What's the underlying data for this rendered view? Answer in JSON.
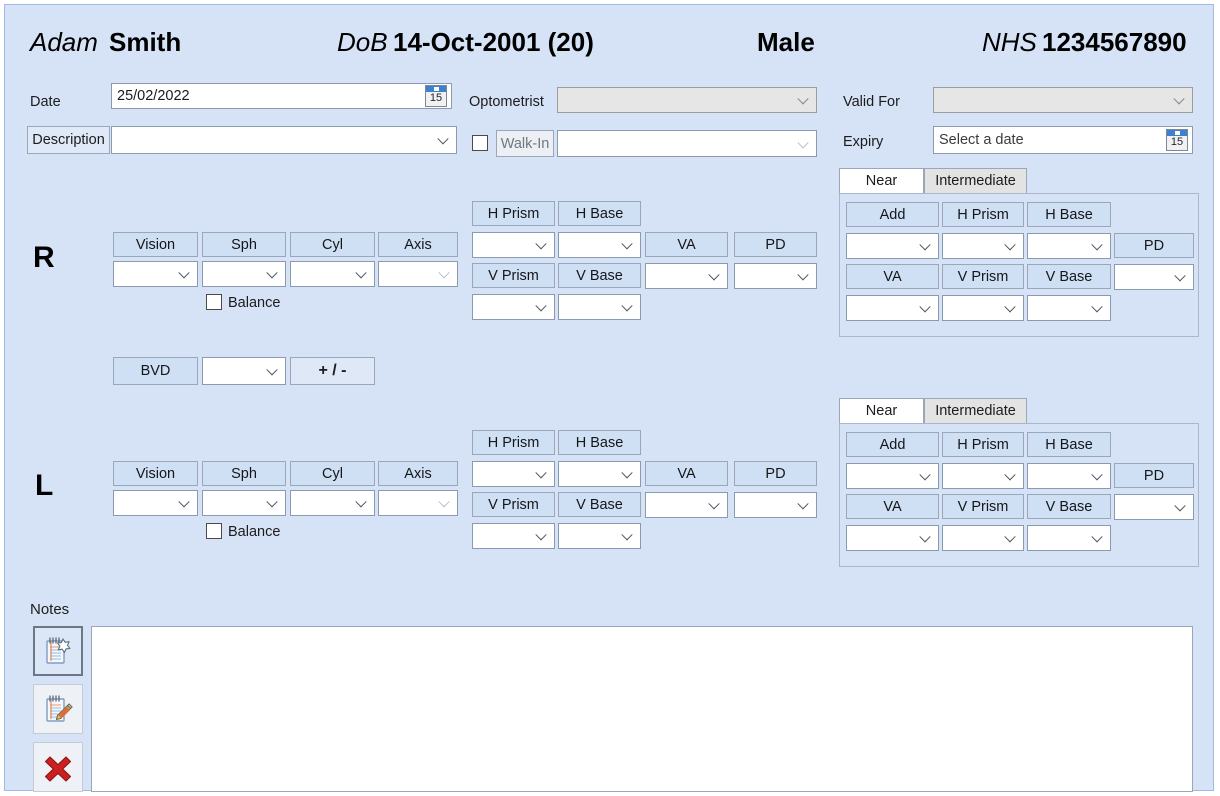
{
  "patient": {
    "first_name": "Adam",
    "last_name": "Smith",
    "dob_label": "DoB",
    "dob_value": "14-Oct-2001 (20)",
    "sex": "Male",
    "nhs_label": "NHS",
    "nhs_value": "1234567890"
  },
  "form": {
    "date_label": "Date",
    "date_value": "25/02/2022",
    "date_picker_icon": "calendar-icon",
    "date_picker_day": "15",
    "description_label": "Description",
    "description_value": "",
    "optometrist_label": "Optometrist",
    "optometrist_value": "",
    "walkin_label": "Walk-In",
    "walkin_checked": false,
    "walkin_value": "",
    "valid_for_label": "Valid For",
    "valid_for_value": "",
    "expiry_label": "Expiry",
    "expiry_placeholder": "Select a date",
    "expiry_picker_icon": "calendar-icon",
    "expiry_picker_day": "15"
  },
  "rx_headers": {
    "vision": "Vision",
    "sph": "Sph",
    "cyl": "Cyl",
    "axis": "Axis",
    "h_prism": "H Prism",
    "h_base": "H Base",
    "v_prism": "V Prism",
    "v_base": "V Base",
    "va": "VA",
    "pd": "PD",
    "add": "Add",
    "balance": "Balance"
  },
  "bvd": {
    "label": "BVD",
    "value": "",
    "sign_toggle_label": "+ / -"
  },
  "eyes": [
    {
      "id": "right",
      "letter": "R",
      "balance_checked": false,
      "vision": "",
      "sph": "",
      "cyl": "",
      "axis": "",
      "h_prism": "",
      "h_base": "",
      "v_prism": "",
      "v_base": "",
      "va": "",
      "pd": "",
      "tabs": [
        {
          "label": "Near",
          "active": true
        },
        {
          "label": "Intermediate",
          "active": false
        }
      ],
      "near": {
        "add": "",
        "h_prism": "",
        "h_base": "",
        "va": "",
        "v_prism": "",
        "v_base": "",
        "pd": ""
      }
    },
    {
      "id": "left",
      "letter": "L",
      "balance_checked": false,
      "vision": "",
      "sph": "",
      "cyl": "",
      "axis": "",
      "h_prism": "",
      "h_base": "",
      "v_prism": "",
      "v_base": "",
      "va": "",
      "pd": "",
      "tabs": [
        {
          "label": "Near",
          "active": true
        },
        {
          "label": "Intermediate",
          "active": false
        }
      ],
      "near": {
        "add": "",
        "h_prism": "",
        "h_base": "",
        "va": "",
        "v_prism": "",
        "v_base": "",
        "pd": ""
      }
    }
  ],
  "notes": {
    "label": "Notes",
    "value": "",
    "buttons": [
      {
        "icon": "note-add-icon",
        "selected": true
      },
      {
        "icon": "note-edit-icon",
        "selected": false
      },
      {
        "icon": "note-delete-icon",
        "selected": false
      }
    ]
  },
  "colors": {
    "background": "#d6e3f7",
    "border": "#9fbce8",
    "header_cell": "#cfdff4",
    "button": "#dfe9f7",
    "disabled": "#e6e6e6",
    "delete_red": "#c81e1e",
    "calendar_blue": "#3f7fd0"
  }
}
